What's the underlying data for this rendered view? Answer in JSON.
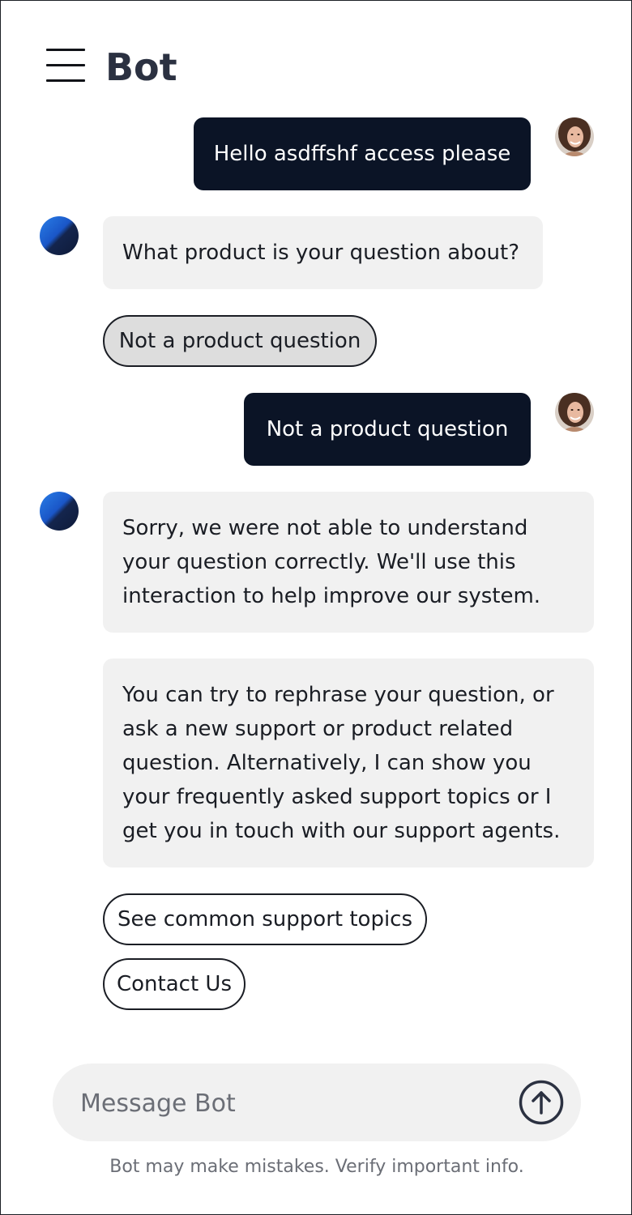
{
  "header": {
    "title": "Bot",
    "menu_icon": "hamburger-menu-icon"
  },
  "conversation": {
    "messages": [
      {
        "role": "user",
        "text": "Hello asdffshf access please"
      },
      {
        "role": "bot",
        "text": "What product is your question about?"
      },
      {
        "role": "bot_option",
        "text": "Not a product question",
        "selected": true
      },
      {
        "role": "user",
        "text": "Not a product question"
      },
      {
        "role": "bot",
        "text": "Sorry, we were not able to understand your question correctly. We'll use this interaction to help improve our system."
      },
      {
        "role": "bot",
        "text": "You can try to rephrase your question, or ask a new support or product related question. Alternatively, I can show you your frequently asked support topics or I get you in touch with our support agents."
      }
    ],
    "options": [
      {
        "text": "See common support topics"
      },
      {
        "text": "Contact Us"
      }
    ]
  },
  "composer": {
    "placeholder": "Message Bot",
    "value": "",
    "send_icon": "arrow-up-circle-icon"
  },
  "footer": {
    "disclaimer": "Bot may make mistakes. Verify important info."
  },
  "colors": {
    "user_bubble": "#0b1426",
    "bot_bubble": "#f1f1f1",
    "title": "#2b3141",
    "chip_selected": "#dddddd"
  }
}
